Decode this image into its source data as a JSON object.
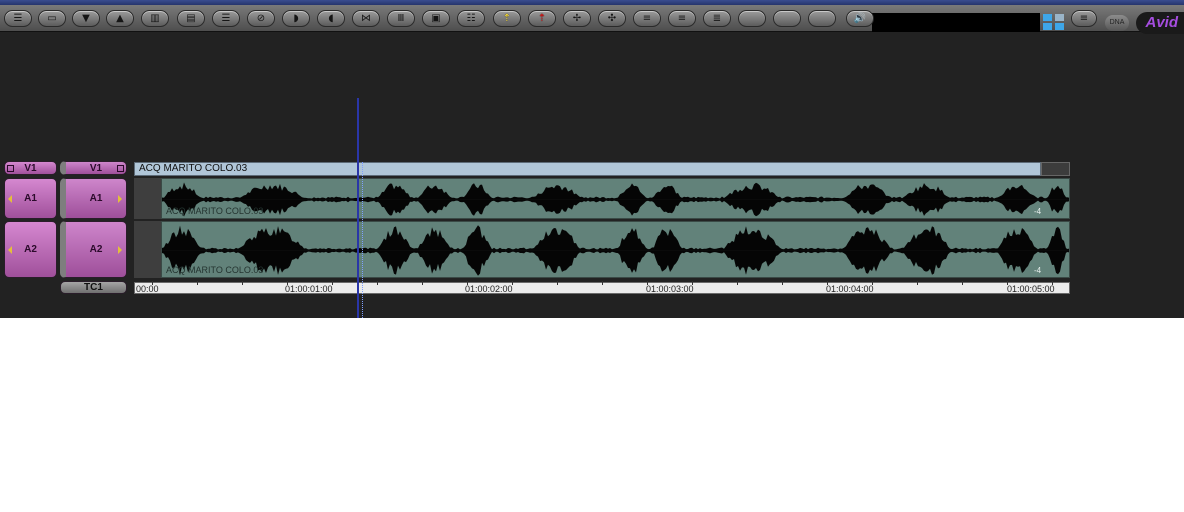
{
  "toolbar": {
    "buttons": [
      {
        "name": "track-settings-icon",
        "glyph": "☰"
      },
      {
        "name": "monitor-icon",
        "glyph": "▭"
      },
      {
        "name": "lower-icon",
        "glyph": "▼"
      },
      {
        "name": "raise-icon",
        "glyph": "▲"
      },
      {
        "name": "overwrite-icon",
        "glyph": "▥"
      },
      {
        "name": "splice-icon",
        "glyph": "▤"
      },
      {
        "name": "extract-icon",
        "glyph": "☰"
      },
      {
        "name": "mute-icon",
        "glyph": "⊘"
      },
      {
        "name": "ripple-right-icon",
        "glyph": "◗"
      },
      {
        "name": "ripple-left-icon",
        "glyph": "◖"
      },
      {
        "name": "trim-icon",
        "glyph": "⋈"
      },
      {
        "name": "columns-icon",
        "glyph": "Ⅲ"
      },
      {
        "name": "segment-icon",
        "glyph": "▣"
      },
      {
        "name": "stack-icon",
        "glyph": "☷"
      },
      {
        "name": "lift-icon",
        "glyph": "⇡"
      },
      {
        "name": "extract-red-icon",
        "glyph": "⇡"
      },
      {
        "name": "sync-icon",
        "glyph": "✢"
      },
      {
        "name": "cut-icon",
        "glyph": "✣"
      },
      {
        "name": "patch-icon",
        "glyph": "≡"
      },
      {
        "name": "shift-icon",
        "glyph": "≡"
      },
      {
        "name": "rewind-icon",
        "glyph": "≣"
      },
      {
        "name": "blank-1",
        "glyph": ""
      },
      {
        "name": "blank-2",
        "glyph": ""
      },
      {
        "name": "blank-3",
        "glyph": ""
      },
      {
        "name": "speaker-icon",
        "glyph": "🔊"
      }
    ],
    "dna_label": "DNA",
    "brand": "Avid"
  },
  "tracks": {
    "source_v": "V1",
    "record_v": "V1",
    "source_a1": "A1",
    "record_a1": "A1",
    "source_a2": "A2",
    "record_a2": "A2",
    "timecode": "TC1"
  },
  "timeline": {
    "video_clip": "ACQ MARITO COLO.03",
    "audio_clip_a1": "ACQ MARITO COLO.03",
    "audio_clip_a2": "ACQ MARITO COLO.03",
    "gain_a1": "-4",
    "gain_a2": "-4",
    "timecodes": [
      "00:00",
      "01:00:01:00",
      "01:00:02:00",
      "01:00:03:00",
      "01:00:04:00",
      "01:00:05:00"
    ]
  },
  "colors": {
    "accent": "#a64de0",
    "track_pill": "#c07ac0",
    "clip_audio": "#62827a",
    "clip_video": "#b0c6d8"
  }
}
